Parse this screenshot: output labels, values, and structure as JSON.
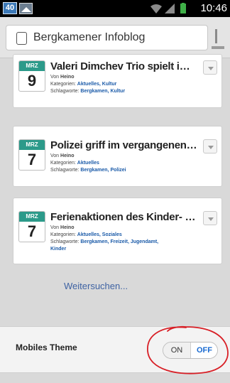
{
  "status_bar": {
    "notification_count": "40",
    "time": "10:46"
  },
  "browser": {
    "url_title": "Bergkamener Infoblog"
  },
  "posts": [
    {
      "month": "MRZ",
      "day": "9",
      "title": "Valeri Dimchev Trio spielt im Tra...",
      "author_label": "Von",
      "author": "Heino",
      "categories_label": "Kategorien:",
      "categories": "Aktuelles, Kultur",
      "tags_label": "Schlagworte:",
      "tags": "Bergkamen, Kultur"
    },
    {
      "month": "MRZ",
      "day": "7",
      "title": "Polizei griff im vergangenen Jah...",
      "author_label": "Von",
      "author": "Heino",
      "categories_label": "Kategorien:",
      "categories": "Aktuelles",
      "tags_label": "Schlagworte:",
      "tags": "Bergkamen, Polizei"
    },
    {
      "month": "MRZ",
      "day": "7",
      "title": "Ferienaktionen des Kinder- und ...",
      "author_label": "Von",
      "author": "Heino",
      "categories_label": "Kategorien:",
      "categories": "Aktuelles, Soziales",
      "tags_label": "Schlagworte:",
      "tags": "Bergkamen, Freizeit, Jugendamt,",
      "tags_line2": "Kinder"
    }
  ],
  "more_link": "Weitersuchen...",
  "theme": {
    "label": "Mobiles Theme",
    "on_label": "ON",
    "off_label": "OFF",
    "selected": "OFF"
  },
  "colors": {
    "date_header": "#2c9a8a",
    "link": "#1a5aa8",
    "toggle_active": "#1a6bd1",
    "annotation": "#d81f26"
  }
}
